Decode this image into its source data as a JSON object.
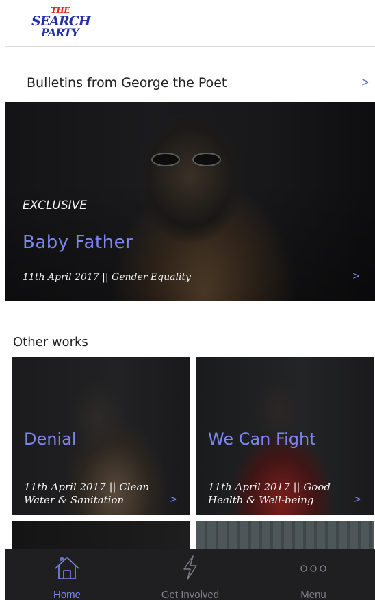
{
  "brand": {
    "logo_text": [
      "THE",
      "SEARCH",
      "PARTY"
    ]
  },
  "bulletins": {
    "heading": "Bulletins from George the Poet",
    "chevron": ">"
  },
  "hero": {
    "tag": "EXCLUSIVE",
    "title": "Baby Father",
    "meta": "11th April 2017 || Gender Equality",
    "chevron": ">"
  },
  "other_works": {
    "heading": "Other works",
    "cards": [
      {
        "title": "Denial",
        "meta": "11th April 2017 || Clean Water & Sanitation",
        "chevron": ">"
      },
      {
        "title": "We Can Fight",
        "meta": "11th April 2017 || Good Health & Well-being",
        "chevron": ">"
      }
    ]
  },
  "tabbar": {
    "tabs": [
      {
        "label": "Home",
        "icon": "home-icon",
        "active": true
      },
      {
        "label": "Get Involved",
        "icon": "lightning-icon",
        "active": false
      },
      {
        "label": "Menu",
        "icon": "more-dots-icon",
        "active": false
      }
    ]
  },
  "colors": {
    "accent": "#7d86ef",
    "tabbar_bg": "#1f1f21",
    "logo_blue": "#2330a8",
    "logo_red": "#e0271d"
  }
}
